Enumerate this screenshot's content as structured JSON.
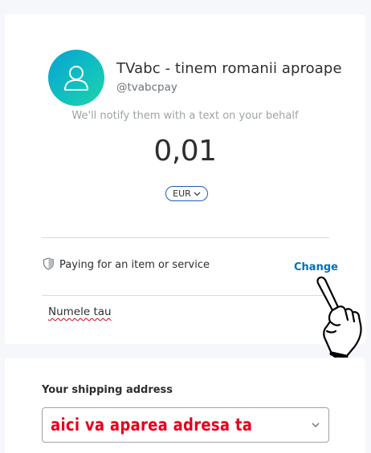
{
  "recipient": {
    "name": "TVabc - tinem romanii aproape",
    "handle": "@tvabcpay",
    "avatar_icon": "user-icon",
    "avatar_gradient": [
      "#0aa1d2",
      "#1ed3a6"
    ]
  },
  "notify_text": "We'll notify them with a text on your behalf",
  "amount": "0,01",
  "currency": "EUR",
  "payment": {
    "type_label": "Paying for an item or service",
    "change_label": "Change",
    "shield_icon": "shield-icon"
  },
  "note": {
    "text": "Numele tau"
  },
  "shipping": {
    "label": "Your shipping address",
    "value": "aici va aparea adresa ta",
    "value_color": "#e5001a"
  },
  "colors": {
    "link": "#0070ba",
    "currency_border": "#1e5db6"
  }
}
